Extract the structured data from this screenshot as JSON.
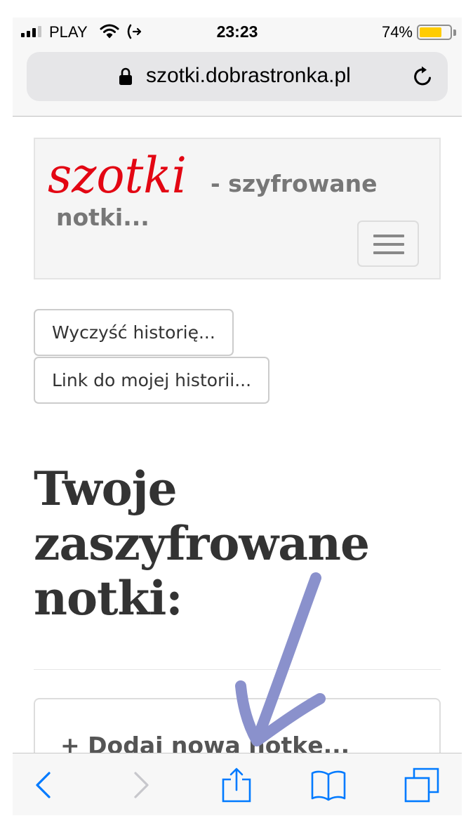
{
  "status_bar": {
    "carrier": "PLAY",
    "time": "23:23",
    "battery_percent": "74%",
    "battery_level": 0.74,
    "battery_color": "#ffcc00",
    "icons": [
      "signal-icon",
      "wifi-icon",
      "call-forwarding-icon",
      "battery-icon"
    ]
  },
  "url_bar": {
    "domain": "szotki.dobrastronka.pl",
    "icons": [
      "lock-icon",
      "reload-icon"
    ]
  },
  "navbar": {
    "logo_text": "szotki",
    "logo_color": "#e30613",
    "tagline": "- szyfrowane notki...",
    "toggle_icon": "hamburger-menu-icon"
  },
  "buttons": {
    "clear_history": "Wyczyść historię...",
    "history_link": "Link do mojej historii..."
  },
  "main": {
    "heading": "Twoje zaszyfrowane notki:",
    "add_note": "+ Dodaj nową notkę..."
  },
  "annotation": {
    "arrow_color": "#8a91cc"
  },
  "toolbar": {
    "items": [
      "back-icon",
      "forward-icon",
      "share-icon",
      "bookmarks-icon",
      "tabs-icon"
    ],
    "accent_color": "#007aff",
    "disabled_color": "#c7c7cc"
  }
}
